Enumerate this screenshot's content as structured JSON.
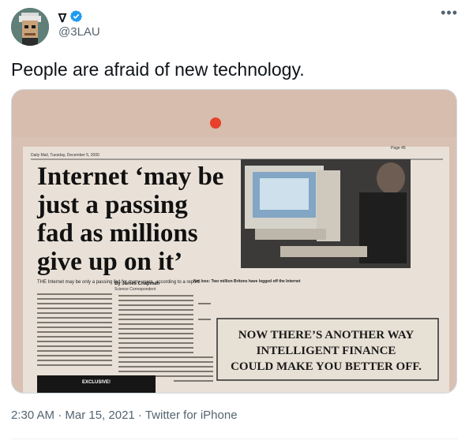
{
  "author": {
    "display_name": "∇",
    "handle": "@3LAU",
    "verified": true
  },
  "tweet": {
    "text": "People are afraid of new technology.",
    "timestamp": "2:30 AM · Mar 15, 2021",
    "separator": " · ",
    "source": "Twitter for iPhone"
  },
  "clipping": {
    "masthead": "Daily Mail, Tuesday, December 5, 2000",
    "page": "Page 45",
    "headline_lines": [
      "Internet ‘may be",
      "just a passing",
      "fad as millions",
      "give up on it’"
    ],
    "lede": "THE Internet may be only a passing fad for many users, according to a report.",
    "byline": "By James Chapman",
    "byline_role": "Science Correspondent",
    "caption": "Net loss: Two million Britons have logged off the Internet",
    "ad_lines": [
      "NOW THERE’S ANOTHER WAY",
      "INTELLIGENT FINANCE",
      "COULD MAKE YOU BETTER OFF."
    ],
    "exclusive_label": "EXCLUSIVE!"
  },
  "colors": {
    "verified_blue": "#1d9bf0",
    "meta_gray": "#536471"
  },
  "icons": {
    "more": "more-horizontal-icon",
    "verified": "verified-badge-icon"
  }
}
